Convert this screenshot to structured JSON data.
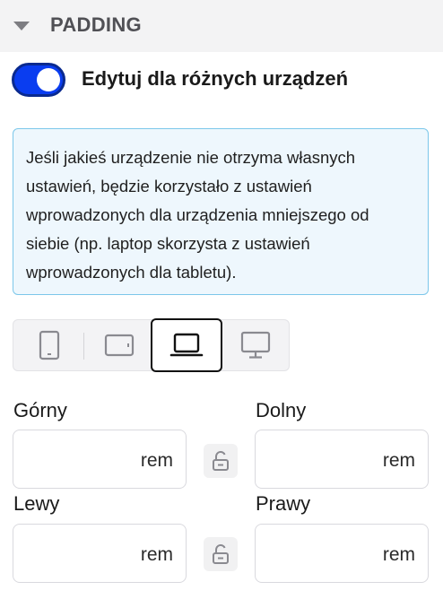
{
  "section": {
    "title": "PADDING",
    "caret_icon": "caret-down-icon"
  },
  "responsive_toggle": {
    "label": "Edytuj dla różnych urządzeń",
    "enabled": true,
    "color": "#0a3df0"
  },
  "info": {
    "text": "Jeśli jakieś urządzenie nie otrzyma własnych ustawień, będzie korzystało z ustawień wprowadzonych dla urządzenia mniejszego od siebie (np. laptop skorzysta z ustawień wprowadzonych dla tabletu).",
    "background": "#eef7fd",
    "border": "#7cc7ea"
  },
  "devices": {
    "items": [
      {
        "id": "mobile",
        "icon": "smartphone-icon",
        "active": false
      },
      {
        "id": "tablet",
        "icon": "tablet-icon",
        "active": false
      },
      {
        "id": "laptop",
        "icon": "laptop-icon",
        "active": true
      },
      {
        "id": "desktop",
        "icon": "monitor-icon",
        "active": false
      }
    ]
  },
  "fields": {
    "top": {
      "label": "Górny",
      "value": "",
      "unit": "rem"
    },
    "bottom": {
      "label": "Dolny",
      "value": "",
      "unit": "rem"
    },
    "left": {
      "label": "Lewy",
      "value": "",
      "unit": "rem"
    },
    "right": {
      "label": "Prawy",
      "value": "",
      "unit": "rem"
    },
    "link_icon": "unlock-icon"
  }
}
